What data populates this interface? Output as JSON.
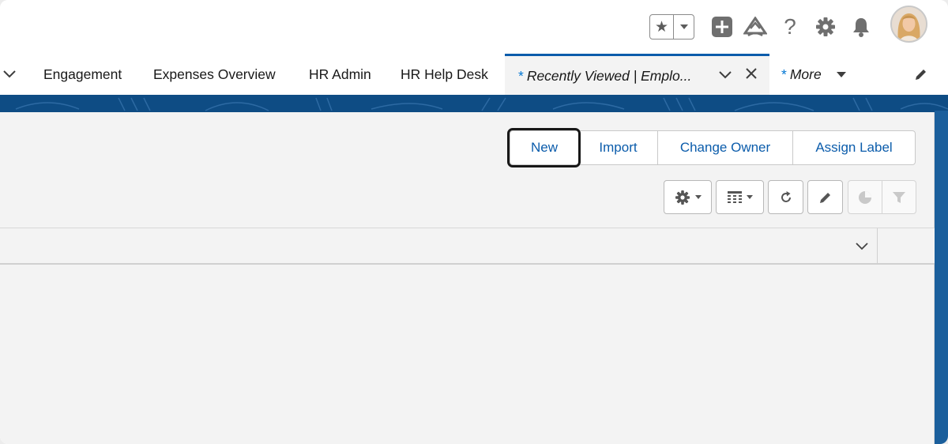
{
  "header": {
    "favorites_icon": "star-icon",
    "favorites_menu_icon": "caret-down-icon",
    "icons": [
      "add-icon",
      "trailhead-icon",
      "help-icon",
      "setup-gear-icon",
      "notifications-bell-icon"
    ],
    "help_glyph": "?",
    "avatar_icon": "user-avatar"
  },
  "tabs": {
    "items": [
      {
        "label": "Engagement"
      },
      {
        "label": "Expenses Overview"
      },
      {
        "label": "HR Admin"
      },
      {
        "label": "HR Help Desk"
      }
    ],
    "active": {
      "asterisk": "*",
      "label": "Recently Viewed | Emplo..."
    },
    "more": {
      "asterisk": "*",
      "label": "More"
    }
  },
  "actions": {
    "buttons": [
      {
        "label": "New"
      },
      {
        "label": "Import"
      },
      {
        "label": "Change Owner"
      },
      {
        "label": "Assign Label"
      }
    ]
  },
  "list_controls": {
    "icons": [
      "settings-gear-icon",
      "display-as-table-icon",
      "refresh-icon",
      "edit-pencil-icon",
      "chart-icon",
      "filter-icon"
    ]
  },
  "colors": {
    "accent": "#0b5cab",
    "asterisk": "#0176d3",
    "banner": "#0e4c84",
    "active_tab_bg": "#f3f3f3"
  }
}
